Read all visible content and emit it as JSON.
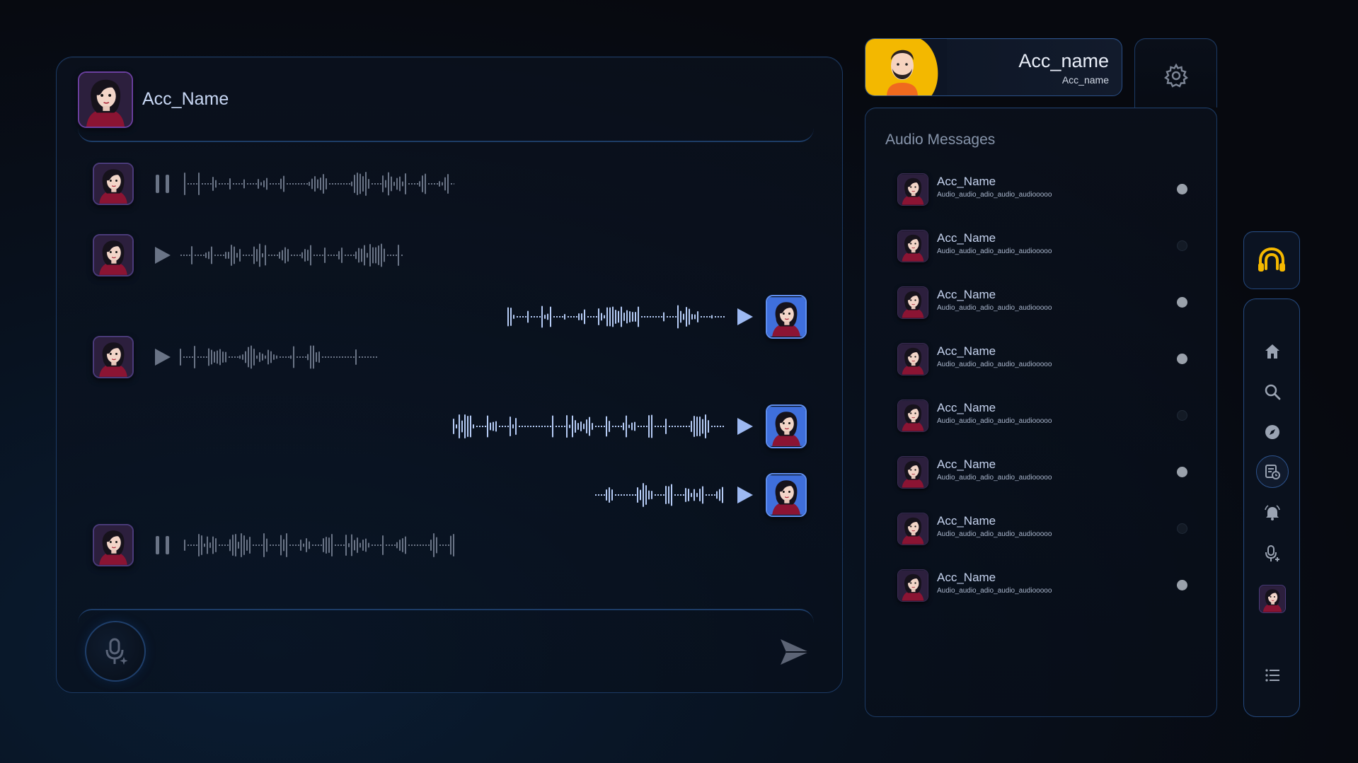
{
  "chat": {
    "header_name": "Acc_Name"
  },
  "profile": {
    "name": "Acc_name",
    "handle": "Acc_name"
  },
  "audio_list": {
    "title": "Audio Messages",
    "items": [
      {
        "name": "Acc_Name",
        "subtitle": "Audio_audio_adio_audio_audiooooo",
        "unread": true
      },
      {
        "name": "Acc_Name",
        "subtitle": "Audio_audio_adio_audio_audiooooo",
        "unread": false
      },
      {
        "name": "Acc_Name",
        "subtitle": "Audio_audio_adio_audio_audiooooo",
        "unread": true
      },
      {
        "name": "Acc_Name",
        "subtitle": "Audio_audio_adio_audio_audiooooo",
        "unread": true
      },
      {
        "name": "Acc_Name",
        "subtitle": "Audio_audio_adio_audio_audiooooo",
        "unread": false
      },
      {
        "name": "Acc_Name",
        "subtitle": "Audio_audio_adio_audio_audiooooo",
        "unread": true
      },
      {
        "name": "Acc_Name",
        "subtitle": "Audio_audio_adio_audio_audiooooo",
        "unread": false
      },
      {
        "name": "Acc_Name",
        "subtitle": "Audio_audio_adio_audio_audiooooo",
        "unread": true
      }
    ]
  },
  "messages": [
    {
      "direction": "incoming",
      "state": "playing"
    },
    {
      "direction": "incoming",
      "state": "paused"
    },
    {
      "direction": "outgoing",
      "state": "paused"
    },
    {
      "direction": "incoming",
      "state": "paused"
    },
    {
      "direction": "outgoing",
      "state": "paused"
    },
    {
      "direction": "outgoing",
      "state": "paused"
    },
    {
      "direction": "incoming",
      "state": "playing"
    }
  ],
  "icons": {
    "composer_mic": "mic-sparkle-icon",
    "send": "send-icon",
    "settings": "gear-icon",
    "logo": "headphones-logo-icon",
    "nav": [
      "home-icon",
      "search-icon",
      "compass-icon",
      "library-icon",
      "bell-icon",
      "mic-add-icon",
      "avatar",
      "list-icon"
    ]
  },
  "colors": {
    "accent_blue": "#8fb2f5",
    "incoming_wave": "#6a7486",
    "outgoing_wave": "#b6ccf6",
    "logo_yellow": "#f5b800",
    "panel_border": "#1c3a64"
  }
}
